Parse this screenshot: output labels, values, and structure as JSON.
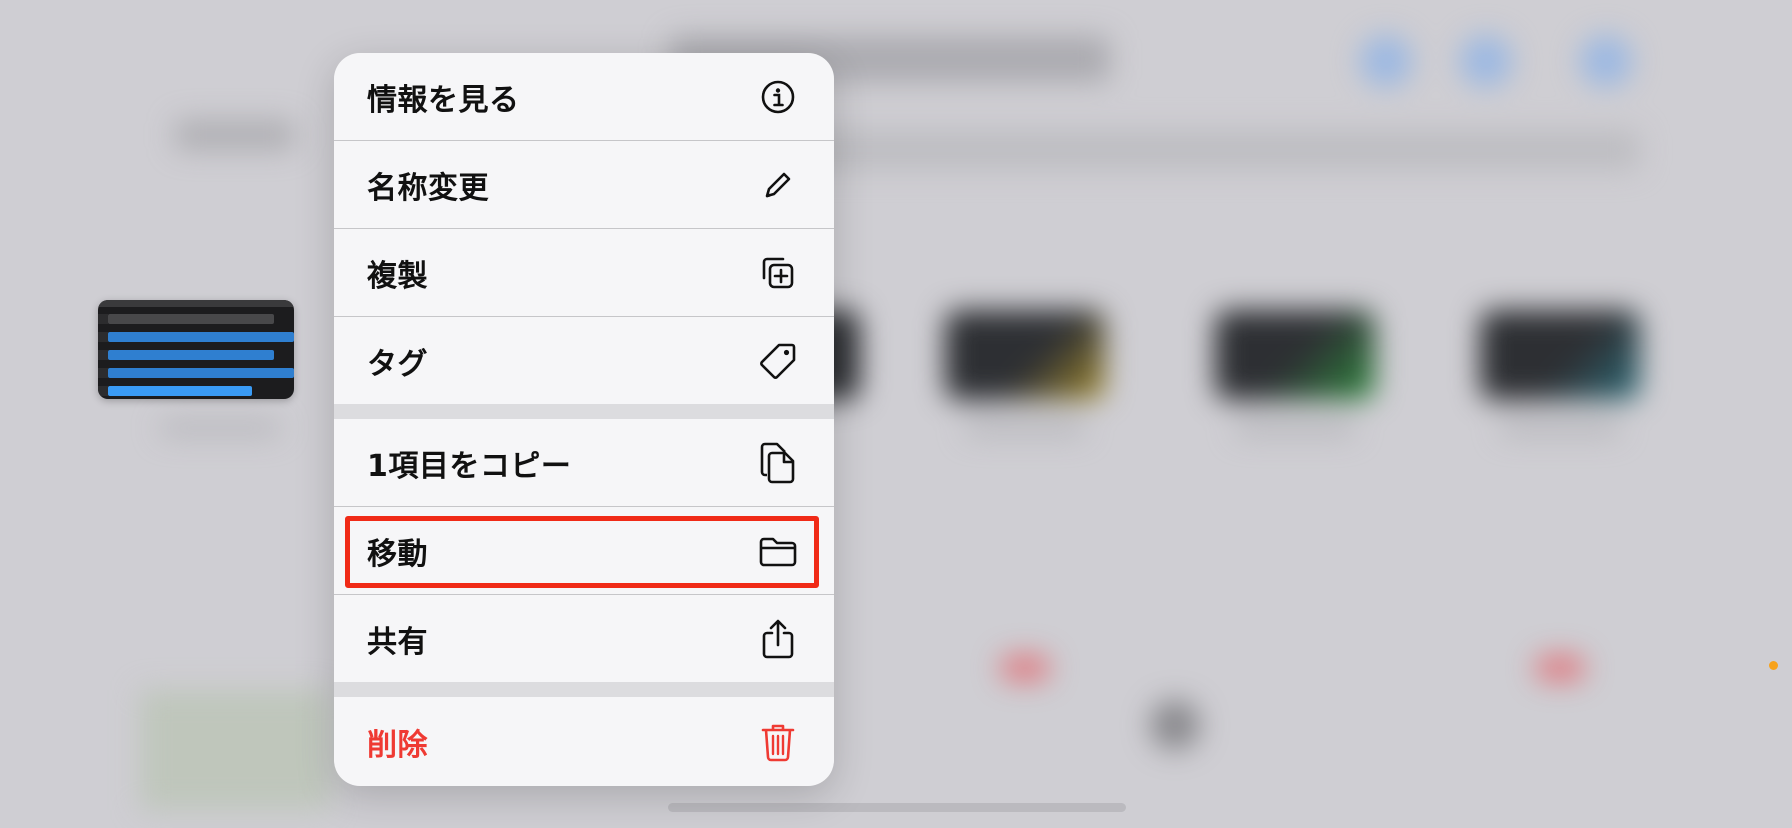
{
  "menu": {
    "items": [
      {
        "label": "情報を見る",
        "icon": "info-circle-icon"
      },
      {
        "label": "名称変更",
        "icon": "pencil-icon"
      },
      {
        "label": "複製",
        "icon": "duplicate-icon"
      },
      {
        "label": "タグ",
        "icon": "tag-icon"
      },
      {
        "label": "1項目をコピー",
        "icon": "copy-document-icon"
      },
      {
        "label": "移動",
        "icon": "folder-icon"
      },
      {
        "label": "共有",
        "icon": "share-icon"
      },
      {
        "label": "削除",
        "icon": "trash-icon"
      }
    ],
    "highlighted_item": "移動"
  },
  "colors": {
    "menu_background": "#f2f2f4",
    "text": "#111111",
    "danger": "#ef3a33",
    "highlight_border": "#f02a17",
    "track_blue": "#2f7fd0",
    "track_blue_bright": "#3a9bf5",
    "status_dot": "#f7a21b"
  }
}
